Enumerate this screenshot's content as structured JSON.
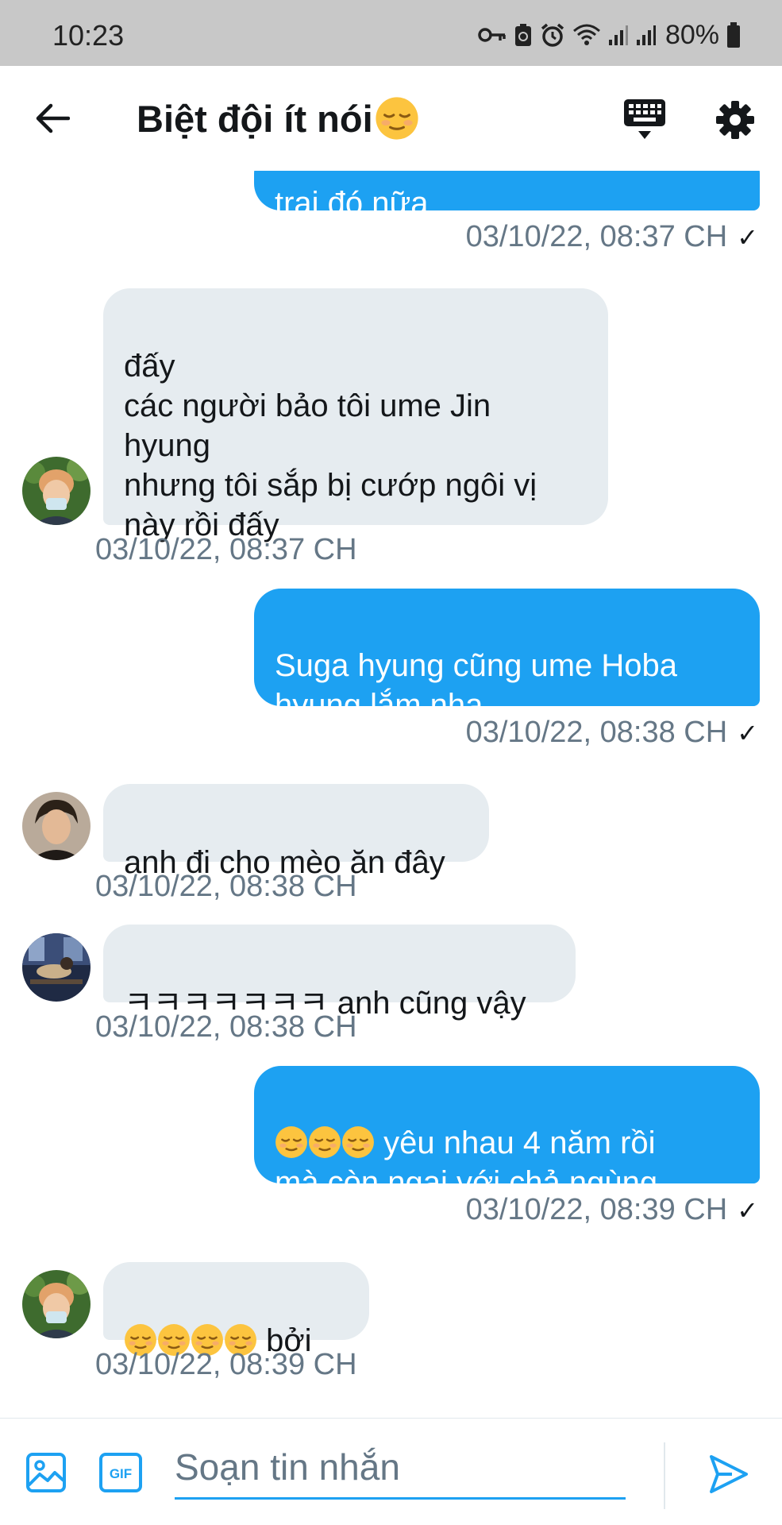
{
  "status_bar": {
    "time": "10:23",
    "battery": "80%"
  },
  "header": {
    "title": "Biệt đội ít nói",
    "title_emoji": "relieved-face-icon"
  },
  "messages": [
    {
      "direction": "out",
      "text": "trai đó nữa",
      "time": "03/10/22, 08:37 CH",
      "status": "✓"
    },
    {
      "direction": "in",
      "text": "đấy\ncác người bảo tôi ume Jin\nhyung\nnhưng tôi sắp bị cướp ngôi vị\nnày rồi đấy",
      "time": "03/10/22, 08:37 CH"
    },
    {
      "direction": "out",
      "text": "Suga hyung cũng ume Hoba\nhyung lắm nha",
      "time": "03/10/22, 08:38 CH",
      "status": "✓"
    },
    {
      "direction": "in",
      "text": "anh đi cho mèo ăn đây",
      "time": "03/10/22, 08:38 CH"
    },
    {
      "direction": "in",
      "text": "ㅋㅋㅋㅋㅋㅋㅋ anh cũng vậy",
      "time": "03/10/22, 08:38 CH"
    },
    {
      "direction": "out",
      "text_line1": "yêu nhau 4 năm rồi",
      "text_line2": "mà còn ngại với chả ngùng",
      "emoji_count": 3,
      "time": "03/10/22, 08:39 CH",
      "status": "✓"
    },
    {
      "direction": "in",
      "text": "bởi",
      "emoji_count": 4,
      "time": "03/10/22, 08:39 CH"
    }
  ],
  "composer": {
    "placeholder": "Soạn tin nhắn"
  },
  "colors": {
    "accent": "#1da1f2",
    "incoming_bubble": "#e6ecf0",
    "timestamp": "#657786",
    "status_bar": "#c8c8c8"
  }
}
